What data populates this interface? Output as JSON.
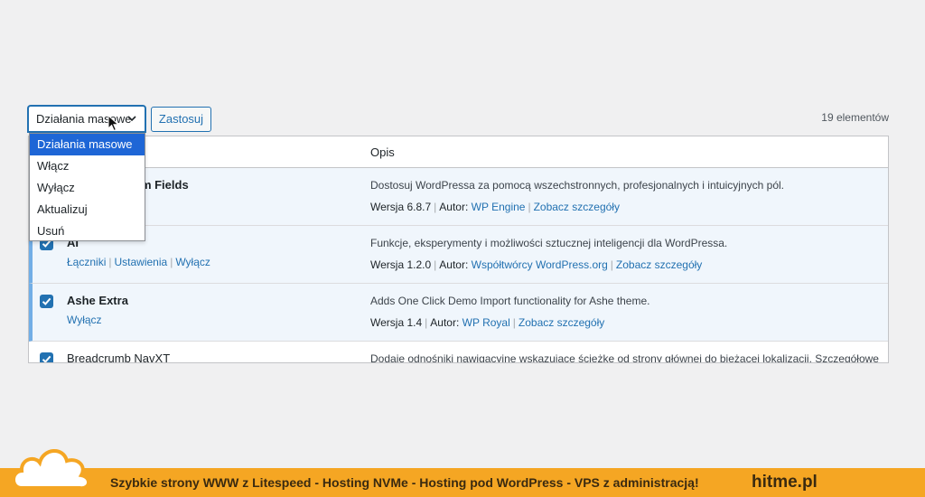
{
  "toolbar": {
    "bulk_selected": "Działania masowe",
    "apply_label": "Zastosuj",
    "items_count": "19 elementów"
  },
  "dropdown": {
    "options": [
      "Działania masowe",
      "Włącz",
      "Wyłącz",
      "Aktualizuj",
      "Usuń"
    ]
  },
  "table": {
    "header_desc": "Opis",
    "rows": [
      {
        "name": "om Fields",
        "actions": [],
        "description": "Dostosuj WordPressa za pomocą wszechstronnych, profesjonalnych i intuicyjnych pól.",
        "version": "Wersja 6.8.7",
        "author_label": "Autor:",
        "author": "WP Engine",
        "details": "Zobacz szczegóły"
      },
      {
        "name": "AI",
        "actions": [
          "Łączniki",
          "Ustawienia",
          "Wyłącz"
        ],
        "description": "Funkcje, eksperymenty i możliwości sztucznej inteligencji dla WordPressa.",
        "version": "Wersja 1.2.0",
        "author_label": "Autor:",
        "author": "Współtwórcy WordPress.org",
        "details": "Zobacz szczegóły"
      },
      {
        "name": "Ashe Extra",
        "actions": [
          "Wyłącz"
        ],
        "description": "Adds One Click Demo Import functionality for Ashe theme.",
        "version": "Wersja 1.4",
        "author_label": "Autor:",
        "author": "WP Royal",
        "details": "Zobacz szczegóły"
      },
      {
        "name": "Breadcrumb NavXT",
        "actions": [],
        "description": "Dodaje odnośniki nawigacyjne wskazujące ścieżkę od strony głównej do bieżącej lokalizacji. Szczegółowe"
      }
    ]
  },
  "banner": {
    "text": "Szybkie strony WWW z Litespeed - Hosting  NVMe - Hosting pod WordPress - VPS z administracją!",
    "brand": "hitme.pl"
  },
  "colors": {
    "accent": "#2271b1",
    "active_row_bg": "#f0f6fc",
    "active_row_border": "#72aee6",
    "dropdown_selected": "#1e66d6",
    "banner_bg": "#f5a623"
  },
  "icons": {
    "select_chevron": "chevron-down-icon",
    "checkbox_check": "checkmark-icon",
    "mouse": "cursor-arrow-icon",
    "logo": "cloud-logo-icon"
  }
}
